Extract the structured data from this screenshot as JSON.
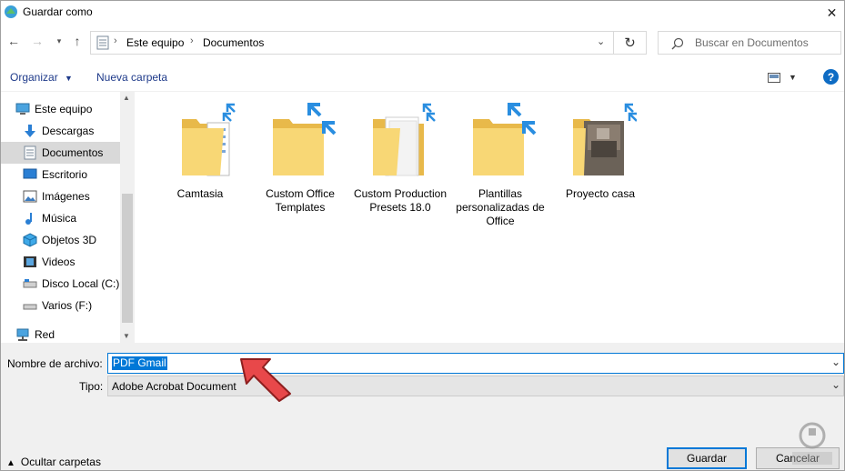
{
  "window": {
    "title": "Guardar como"
  },
  "address": {
    "crumbs": [
      "Este equipo",
      "Documentos"
    ]
  },
  "search": {
    "placeholder": "Buscar en Documentos"
  },
  "toolbar": {
    "organize": "Organizar",
    "new_folder": "Nueva carpeta",
    "help": "?"
  },
  "sidebar": {
    "items": [
      {
        "label": "Este equipo",
        "icon": "computer-icon"
      },
      {
        "label": "Descargas",
        "icon": "download-arrow-icon"
      },
      {
        "label": "Documentos",
        "icon": "document-icon",
        "selected": true
      },
      {
        "label": "Escritorio",
        "icon": "desktop-icon"
      },
      {
        "label": "Imágenes",
        "icon": "pictures-icon"
      },
      {
        "label": "Música",
        "icon": "music-note-icon"
      },
      {
        "label": "Objetos 3D",
        "icon": "cube-3d-icon"
      },
      {
        "label": "Videos",
        "icon": "video-film-icon"
      },
      {
        "label": "Disco Local (C:)",
        "icon": "hard-drive-icon"
      },
      {
        "label": "Varios (F:)",
        "icon": "drive-icon"
      },
      {
        "label": "Red",
        "icon": "network-icon"
      }
    ]
  },
  "folders": [
    {
      "name": "Camtasia"
    },
    {
      "name": "Custom Office Templates"
    },
    {
      "name": "Custom Production Presets 18.0"
    },
    {
      "name": "Plantillas personalizadas de Office"
    },
    {
      "name": "Proyecto casa"
    }
  ],
  "form": {
    "filename_label": "Nombre de archivo:",
    "filename_value": "PDF Gmail",
    "type_label": "Tipo:",
    "type_value": "Adobe Acrobat Document"
  },
  "footer": {
    "hide_folders": "Ocultar carpetas",
    "save": "Guardar",
    "cancel": "Cancelar"
  },
  "colors": {
    "accent": "#0078d7",
    "folder": "#f8d775",
    "annotation_arrow": "#e8484a"
  }
}
